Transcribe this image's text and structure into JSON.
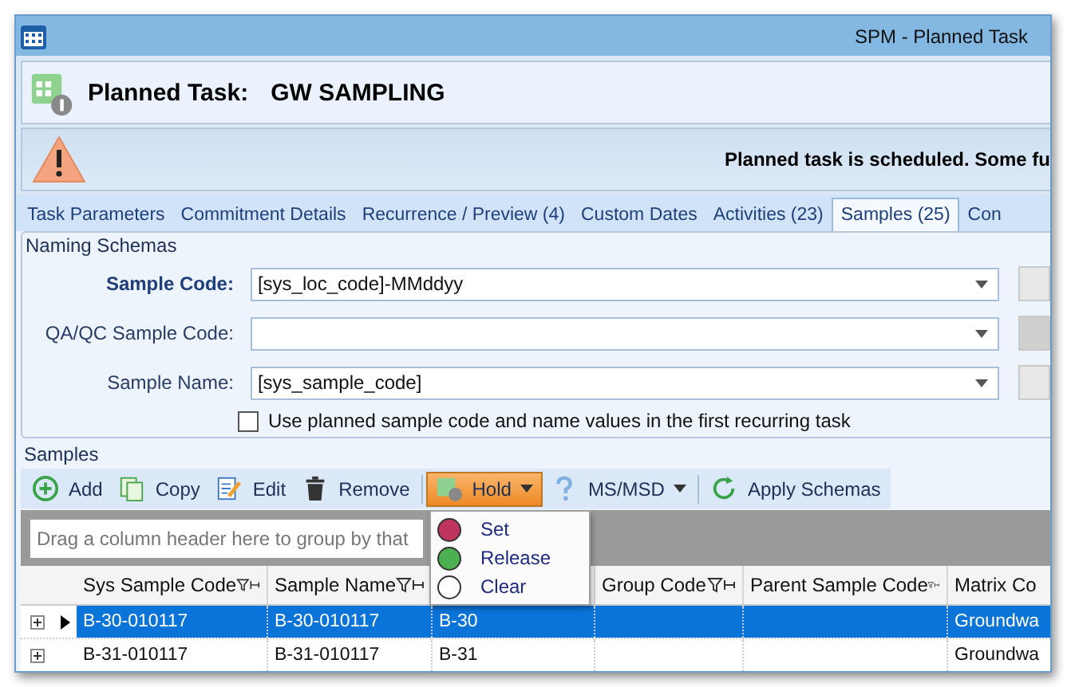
{
  "window": {
    "title": "SPM - Planned Task"
  },
  "header": {
    "label": "Planned Task:",
    "name": "GW SAMPLING"
  },
  "warning": {
    "message": "Planned task is scheduled. Some fu"
  },
  "tabs": [
    {
      "label": "Task Parameters",
      "selected": false
    },
    {
      "label": "Commitment Details",
      "selected": false
    },
    {
      "label": "Recurrence / Preview (4)",
      "selected": false
    },
    {
      "label": "Custom Dates",
      "selected": false
    },
    {
      "label": "Activities (23)",
      "selected": false
    },
    {
      "label": "Samples (25)",
      "selected": true
    },
    {
      "label": "Con",
      "selected": false
    }
  ],
  "naming_schemas": {
    "title": "Naming Schemas",
    "fields": [
      {
        "label": "Sample Code:",
        "value": "[sys_loc_code]-MMddyy",
        "required": true
      },
      {
        "label": "QA/QC Sample Code:",
        "required": false
      },
      {
        "label": "Sample Name:",
        "value": "[sys_sample_code]",
        "required": false
      }
    ],
    "checkbox": {
      "label": "Use planned sample code and name values in the first recurring task",
      "checked": false
    }
  },
  "samples": {
    "title": "Samples",
    "toolbar": [
      {
        "kind": "add",
        "label": "Add"
      },
      {
        "kind": "copy",
        "label": "Copy"
      },
      {
        "kind": "edit",
        "label": "Edit"
      },
      {
        "kind": "remove",
        "label": "Remove"
      },
      {
        "kind": "hold",
        "label": "Hold",
        "dropdown": true,
        "active": true
      },
      {
        "kind": "help",
        "label": "MS/MSD",
        "dropdown": true,
        "active": false
      },
      {
        "kind": "refresh",
        "label": "Apply Schemas"
      }
    ],
    "group_panel": {
      "placeholder": "Drag a column header here to group by that"
    },
    "columns": [
      "Sys Sample Code",
      "Sample Name",
      "",
      "Group Code",
      "Parent Sample Code",
      "Matrix Co"
    ],
    "rows": [
      {
        "selected": true,
        "cells": [
          "B-30-010117",
          "B-30-010117",
          "B-30",
          "",
          "",
          "Groundwa"
        ]
      },
      {
        "selected": false,
        "cells": [
          "B-31-010117",
          "B-31-010117",
          "B-31",
          "",
          "",
          "Groundwa"
        ]
      }
    ],
    "hold_menu": [
      {
        "label": "Set",
        "color": "#c0355e"
      },
      {
        "label": "Release",
        "color": "#4cb050"
      },
      {
        "label": "Clear",
        "color": "#ffffff"
      }
    ]
  }
}
